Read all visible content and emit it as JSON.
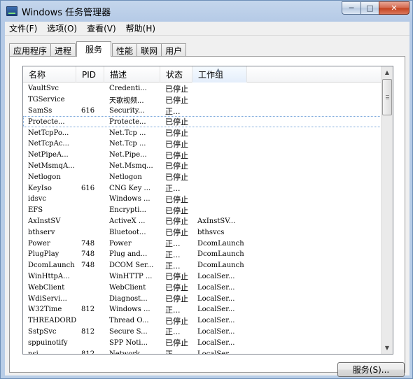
{
  "window": {
    "title": "Windows 任务管理器",
    "min_label": "─",
    "max_label": "□",
    "close_label": "✕"
  },
  "menu": [
    "文件(F)",
    "选项(O)",
    "查看(V)",
    "帮助(H)"
  ],
  "tabs": [
    {
      "label": "应用程序",
      "active": false
    },
    {
      "label": "进程",
      "active": false
    },
    {
      "label": "服务",
      "active": true
    },
    {
      "label": "性能",
      "active": false
    },
    {
      "label": "联网",
      "active": false
    },
    {
      "label": "用户",
      "active": false
    }
  ],
  "columns": [
    "名称",
    "PID",
    "描述",
    "状态",
    "工作组"
  ],
  "sorted_column": "工作组",
  "rows": [
    {
      "name": "VaultSvc",
      "pid": "",
      "desc": "Credenti...",
      "status": "已停止",
      "group": ""
    },
    {
      "name": "TGService",
      "pid": "",
      "desc": "天歌视频...",
      "status": "已停止",
      "group": ""
    },
    {
      "name": "SamSs",
      "pid": "616",
      "desc": "Security...",
      "status": "正...",
      "group": ""
    },
    {
      "name": "Protecte...",
      "pid": "",
      "desc": "Protecte...",
      "status": "已停止",
      "group": ""
    },
    {
      "name": "NetTcpPo...",
      "pid": "",
      "desc": "Net.Tcp ...",
      "status": "已停止",
      "group": ""
    },
    {
      "name": "NetTcpAc...",
      "pid": "",
      "desc": "Net.Tcp ...",
      "status": "已停止",
      "group": ""
    },
    {
      "name": "NetPipeA...",
      "pid": "",
      "desc": "Net.Pipe...",
      "status": "已停止",
      "group": ""
    },
    {
      "name": "NetMsmqA...",
      "pid": "",
      "desc": "Net.Msmq...",
      "status": "已停止",
      "group": ""
    },
    {
      "name": "Netlogon",
      "pid": "",
      "desc": "Netlogon",
      "status": "已停止",
      "group": ""
    },
    {
      "name": "KeyIso",
      "pid": "616",
      "desc": "CNG Key ...",
      "status": "正...",
      "group": ""
    },
    {
      "name": "idsvc",
      "pid": "",
      "desc": "Windows ...",
      "status": "已停止",
      "group": ""
    },
    {
      "name": "EFS",
      "pid": "",
      "desc": "Encrypti...",
      "status": "已停止",
      "group": ""
    },
    {
      "name": "AxInstSV",
      "pid": "",
      "desc": "ActiveX ...",
      "status": "已停止",
      "group": "AxInstSV..."
    },
    {
      "name": "bthserv",
      "pid": "",
      "desc": "Bluetoot...",
      "status": "已停止",
      "group": "bthsvcs"
    },
    {
      "name": "Power",
      "pid": "748",
      "desc": "Power",
      "status": "正...",
      "group": "DcomLaunch"
    },
    {
      "name": "PlugPlay",
      "pid": "748",
      "desc": "Plug and...",
      "status": "正...",
      "group": "DcomLaunch"
    },
    {
      "name": "DcomLaunch",
      "pid": "748",
      "desc": "DCOM Ser...",
      "status": "正...",
      "group": "DcomLaunch"
    },
    {
      "name": "WinHttpA...",
      "pid": "",
      "desc": "WinHTTP ...",
      "status": "已停止",
      "group": "LocalSer..."
    },
    {
      "name": "WebClient",
      "pid": "",
      "desc": "WebClient",
      "status": "已停止",
      "group": "LocalSer..."
    },
    {
      "name": "WdiServi...",
      "pid": "",
      "desc": "Diagnost...",
      "status": "已停止",
      "group": "LocalSer..."
    },
    {
      "name": "W32Time",
      "pid": "812",
      "desc": "Windows ...",
      "status": "正...",
      "group": "LocalSer..."
    },
    {
      "name": "THREADORDER",
      "pid": "",
      "desc": "Thread O...",
      "status": "已停止",
      "group": "LocalSer..."
    },
    {
      "name": "SstpSvc",
      "pid": "812",
      "desc": "Secure S...",
      "status": "正...",
      "group": "LocalSer..."
    },
    {
      "name": "sppuinotify",
      "pid": "",
      "desc": "SPP Noti...",
      "status": "已停止",
      "group": "LocalSer..."
    },
    {
      "name": "nsi",
      "pid": "812",
      "desc": "Network ...",
      "status": "正...",
      "group": "LocalSer..."
    }
  ],
  "focused_row": 3,
  "scrollbar": {
    "up": "▲",
    "down": "▼",
    "position_fraction": 0.0
  },
  "services_button": "服务(S)..."
}
